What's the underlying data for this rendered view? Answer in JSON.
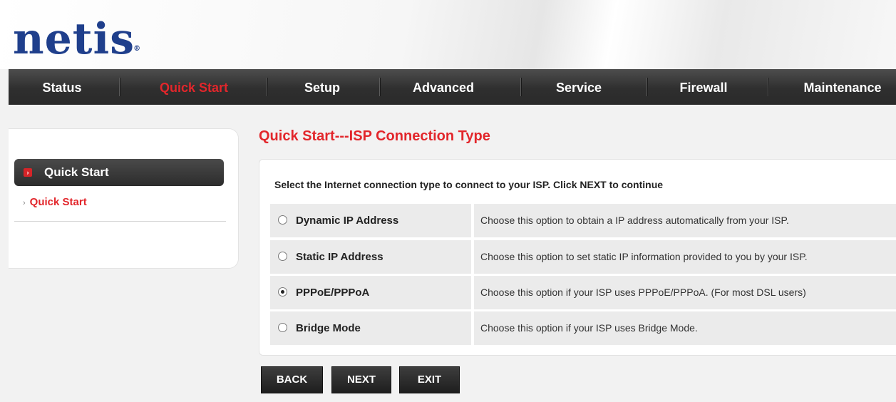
{
  "brand": {
    "logo_text": "netis",
    "logo_mark": "®"
  },
  "nav": {
    "items": [
      {
        "label": "Status"
      },
      {
        "label": "Quick Start"
      },
      {
        "label": "Setup"
      },
      {
        "label": "Advanced"
      },
      {
        "label": "Service"
      },
      {
        "label": "Firewall"
      },
      {
        "label": "Maintenance"
      }
    ],
    "active_index": 1
  },
  "sidebar": {
    "header": "Quick Start",
    "items": [
      {
        "label": "Quick Start"
      }
    ]
  },
  "main": {
    "title": "Quick Start---ISP Connection Type",
    "instruction": "Select the Internet connection type to connect to your ISP. Click NEXT to continue",
    "options": [
      {
        "label": "Dynamic IP Address",
        "description": "Choose this option to obtain a IP address automatically from your ISP.",
        "selected": false
      },
      {
        "label": "Static IP Address",
        "description": "Choose this option to set static IP information provided to you by your ISP.",
        "selected": false
      },
      {
        "label": "PPPoE/PPPoA",
        "description": "Choose this option if your ISP uses PPPoE/PPPoA. (For most DSL users)",
        "selected": true
      },
      {
        "label": "Bridge Mode",
        "description": "Choose this option if your ISP uses Bridge Mode.",
        "selected": false
      }
    ],
    "buttons": {
      "back": "BACK",
      "next": "NEXT",
      "exit": "EXIT"
    }
  },
  "colors": {
    "accent_red": "#e2262b",
    "logo_blue": "#1f3f8c",
    "nav_dark": "#2f2f2f"
  }
}
